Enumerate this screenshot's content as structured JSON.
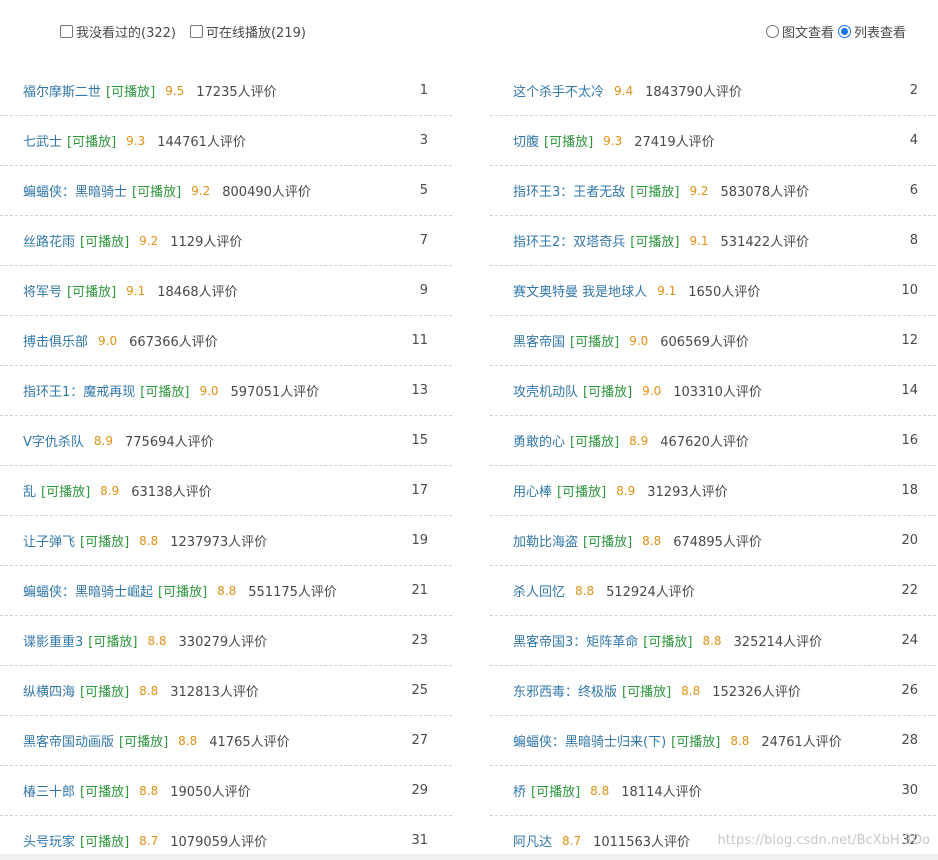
{
  "filters": {
    "unseen_label": "我没看过的(322)",
    "playable_label": "可在线播放(219)"
  },
  "views": {
    "grid_label": "图文查看",
    "list_label": "列表查看"
  },
  "playable_tag": "[可播放]",
  "left_items": [
    {
      "title": "福尔摩斯二世",
      "playable": true,
      "rating": "9.5",
      "count": "17235人评价",
      "rank": "1"
    },
    {
      "title": "七武士",
      "playable": true,
      "rating": "9.3",
      "count": "144761人评价",
      "rank": "3"
    },
    {
      "title": "蝙蝠侠：黑暗骑士",
      "playable": true,
      "rating": "9.2",
      "count": "800490人评价",
      "rank": "5"
    },
    {
      "title": "丝路花雨",
      "playable": true,
      "rating": "9.2",
      "count": "1129人评价",
      "rank": "7"
    },
    {
      "title": "将军号",
      "playable": true,
      "rating": "9.1",
      "count": "18468人评价",
      "rank": "9"
    },
    {
      "title": "搏击俱乐部",
      "playable": false,
      "rating": "9.0",
      "count": "667366人评价",
      "rank": "11"
    },
    {
      "title": "指环王1：魔戒再现",
      "playable": true,
      "rating": "9.0",
      "count": "597051人评价",
      "rank": "13"
    },
    {
      "title": "V字仇杀队",
      "playable": false,
      "rating": "8.9",
      "count": "775694人评价",
      "rank": "15"
    },
    {
      "title": "乱",
      "playable": true,
      "rating": "8.9",
      "count": "63138人评价",
      "rank": "17"
    },
    {
      "title": "让子弹飞",
      "playable": true,
      "rating": "8.8",
      "count": "1237973人评价",
      "rank": "19"
    },
    {
      "title": "蝙蝠侠：黑暗骑士崛起",
      "playable": true,
      "rating": "8.8",
      "count": "551175人评价",
      "rank": "21"
    },
    {
      "title": "谍影重重3",
      "playable": true,
      "rating": "8.8",
      "count": "330279人评价",
      "rank": "23"
    },
    {
      "title": "纵横四海",
      "playable": true,
      "rating": "8.8",
      "count": "312813人评价",
      "rank": "25"
    },
    {
      "title": "黑客帝国动画版",
      "playable": true,
      "rating": "8.8",
      "count": "41765人评价",
      "rank": "27"
    },
    {
      "title": "椿三十郎",
      "playable": true,
      "rating": "8.8",
      "count": "19050人评价",
      "rank": "29"
    },
    {
      "title": "头号玩家",
      "playable": true,
      "rating": "8.7",
      "count": "1079059人评价",
      "rank": "31"
    }
  ],
  "right_items": [
    {
      "title": "这个杀手不太冷",
      "playable": false,
      "rating": "9.4",
      "count": "1843790人评价",
      "rank": "2"
    },
    {
      "title": "切腹",
      "playable": true,
      "rating": "9.3",
      "count": "27419人评价",
      "rank": "4"
    },
    {
      "title": "指环王3：王者无敌",
      "playable": true,
      "rating": "9.2",
      "count": "583078人评价",
      "rank": "6"
    },
    {
      "title": "指环王2：双塔奇兵",
      "playable": true,
      "rating": "9.1",
      "count": "531422人评价",
      "rank": "8"
    },
    {
      "title": "赛文奥特曼 我是地球人",
      "playable": false,
      "rating": "9.1",
      "count": "1650人评价",
      "rank": "10"
    },
    {
      "title": "黑客帝国",
      "playable": true,
      "rating": "9.0",
      "count": "606569人评价",
      "rank": "12"
    },
    {
      "title": "攻壳机动队",
      "playable": true,
      "rating": "9.0",
      "count": "103310人评价",
      "rank": "14"
    },
    {
      "title": "勇敢的心",
      "playable": true,
      "rating": "8.9",
      "count": "467620人评价",
      "rank": "16"
    },
    {
      "title": "用心棒",
      "playable": true,
      "rating": "8.9",
      "count": "31293人评价",
      "rank": "18"
    },
    {
      "title": "加勒比海盗",
      "playable": true,
      "rating": "8.8",
      "count": "674895人评价",
      "rank": "20"
    },
    {
      "title": "杀人回忆",
      "playable": false,
      "rating": "8.8",
      "count": "512924人评价",
      "rank": "22"
    },
    {
      "title": "黑客帝国3：矩阵革命",
      "playable": true,
      "rating": "8.8",
      "count": "325214人评价",
      "rank": "24"
    },
    {
      "title": "东邪西毒：终极版",
      "playable": true,
      "rating": "8.8",
      "count": "152326人评价",
      "rank": "26"
    },
    {
      "title": "蝙蝠侠：黑暗骑士归来(下)",
      "playable": true,
      "rating": "8.8",
      "count": "24761人评价",
      "rank": "28"
    },
    {
      "title": "桥",
      "playable": true,
      "rating": "8.8",
      "count": "18114人评价",
      "rank": "30"
    },
    {
      "title": "阿凡达",
      "playable": false,
      "rating": "8.7",
      "count": "1011563人评价",
      "rank": "32"
    }
  ],
  "watermark": "https://blog.csdn.net/BcXbH 3Do"
}
